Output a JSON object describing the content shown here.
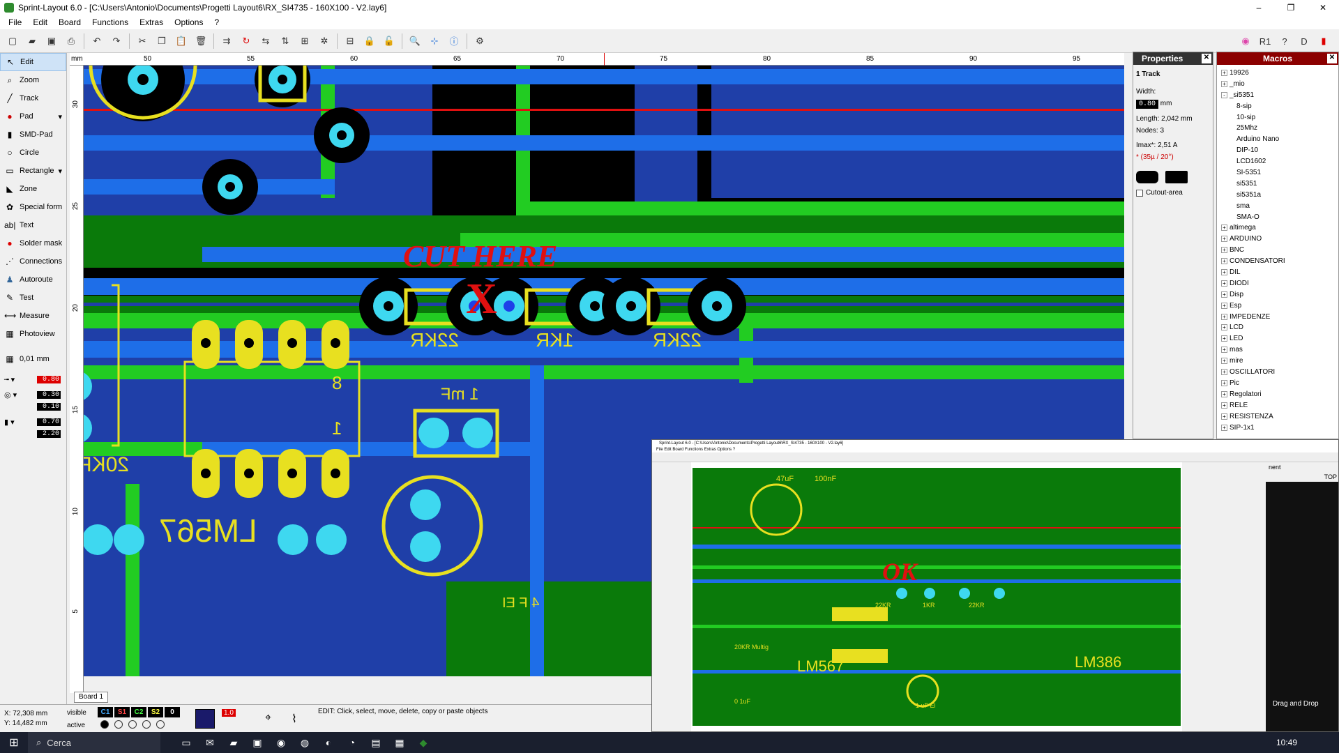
{
  "window": {
    "title": "Sprint-Layout 6.0 - [C:\\Users\\Antonio\\Documents\\Progetti Layout6\\RX_SI4735 - 160X100 - V2.lay6]",
    "minimize": "–",
    "maximize": "❐",
    "close": "✕"
  },
  "menu": [
    "File",
    "Edit",
    "Board",
    "Functions",
    "Extras",
    "Options",
    "?"
  ],
  "left_tools": [
    {
      "label": "Edit",
      "icon": "pointer-icon",
      "glyph": "↖"
    },
    {
      "label": "Zoom",
      "icon": "zoom-icon",
      "glyph": "⌕"
    },
    {
      "label": "Track",
      "icon": "track-icon",
      "glyph": "╱"
    },
    {
      "label": "Pad",
      "icon": "pad-icon",
      "glyph": "●"
    },
    {
      "label": "SMD-Pad",
      "icon": "smd-pad-icon",
      "glyph": "▮"
    },
    {
      "label": "Circle",
      "icon": "circle-icon",
      "glyph": "○"
    },
    {
      "label": "Rectangle",
      "icon": "rectangle-icon",
      "glyph": "▭"
    },
    {
      "label": "Zone",
      "icon": "zone-icon",
      "glyph": "◣"
    },
    {
      "label": "Special form",
      "icon": "special-form-icon",
      "glyph": "✿"
    },
    {
      "label": "Text",
      "icon": "text-icon",
      "glyph": "ab"
    },
    {
      "label": "Solder mask",
      "icon": "solder-mask-icon",
      "glyph": "●"
    },
    {
      "label": "Connections",
      "icon": "connections-icon",
      "glyph": "⋰"
    },
    {
      "label": "Autoroute",
      "icon": "autoroute-icon",
      "glyph": "♟"
    },
    {
      "label": "Test",
      "icon": "test-icon",
      "glyph": "✎"
    },
    {
      "label": "Measure",
      "icon": "measure-icon",
      "glyph": "⟷"
    },
    {
      "label": "Photoview",
      "icon": "photoview-icon",
      "glyph": "▦"
    }
  ],
  "grid": "0,01 mm",
  "values": {
    "track_width": "0.80",
    "pad_outer": "0.30",
    "pad_inner": "0.10",
    "smd_w": "0.70",
    "smd_h": "2.20"
  },
  "ruler": {
    "unit": "mm",
    "h_ticks": [
      "50",
      "55",
      "60",
      "65",
      "70",
      "75",
      "80",
      "85",
      "90",
      "95"
    ],
    "v_ticks": [
      "30",
      "25",
      "20",
      "15",
      "10",
      "5"
    ]
  },
  "board": {
    "annotation_cut": "CUT HERE",
    "annotation_x": "X",
    "labels": {
      "r1": "22KR",
      "r2": "1KR",
      "r3": "22KR",
      "cap": "1 mF",
      "r4": "20KR",
      "ic": "LM567",
      "pin8": "8",
      "pin1": "1",
      "fei": "4 F EI"
    }
  },
  "properties": {
    "title": "Properties",
    "object": "1 Track",
    "width_label": "Width:",
    "width_value": "0.80",
    "width_unit": "mm",
    "length": "Length: 2,042 mm",
    "nodes": "Nodes:  3",
    "imax": "Imax*:   2,51 A",
    "imax_note": "* (35µ / 20°)",
    "cutout": "Cutout-area"
  },
  "macros": {
    "title": "Macros",
    "items": [
      {
        "label": "19926",
        "child": false,
        "pm": "+"
      },
      {
        "label": "_mio",
        "child": false,
        "pm": "+"
      },
      {
        "label": "_si5351",
        "child": false,
        "pm": "-"
      },
      {
        "label": "8-sip",
        "child": true
      },
      {
        "label": "10-sip",
        "child": true
      },
      {
        "label": "25Mhz",
        "child": true
      },
      {
        "label": "Arduino Nano",
        "child": true
      },
      {
        "label": "DIP-10",
        "child": true
      },
      {
        "label": "LCD1602",
        "child": true
      },
      {
        "label": "SI-5351",
        "child": true
      },
      {
        "label": "si5351",
        "child": true
      },
      {
        "label": "si5351a",
        "child": true
      },
      {
        "label": "sma",
        "child": true
      },
      {
        "label": "SMA-O",
        "child": true
      },
      {
        "label": "altimega",
        "child": false,
        "pm": "+"
      },
      {
        "label": "ARDUINO",
        "child": false,
        "pm": "+"
      },
      {
        "label": "BNC",
        "child": false,
        "pm": "+"
      },
      {
        "label": "CONDENSATORI",
        "child": false,
        "pm": "+"
      },
      {
        "label": "DIL",
        "child": false,
        "pm": "+"
      },
      {
        "label": "DIODI",
        "child": false,
        "pm": "+"
      },
      {
        "label": "Disp",
        "child": false,
        "pm": "+"
      },
      {
        "label": "Esp",
        "child": false,
        "pm": "+"
      },
      {
        "label": "IMPEDENZE",
        "child": false,
        "pm": "+"
      },
      {
        "label": "LCD",
        "child": false,
        "pm": "+"
      },
      {
        "label": "LED",
        "child": false,
        "pm": "+"
      },
      {
        "label": "mas",
        "child": false,
        "pm": "+"
      },
      {
        "label": "mire",
        "child": false,
        "pm": "+"
      },
      {
        "label": "OSCILLATORI",
        "child": false,
        "pm": "+"
      },
      {
        "label": "Pic",
        "child": false,
        "pm": "+"
      },
      {
        "label": "Regolatori",
        "child": false,
        "pm": "+"
      },
      {
        "label": "RELE",
        "child": false,
        "pm": "+"
      },
      {
        "label": "RESISTENZA",
        "child": false,
        "pm": "+"
      },
      {
        "label": "SIP-1x1",
        "child": false,
        "pm": "+"
      }
    ]
  },
  "status": {
    "x": "X:  72,308 mm",
    "y": "Y:  14,482 mm",
    "visible": "visible",
    "active": "active",
    "layers": [
      "C1",
      "S1",
      "C2",
      "S2",
      "0"
    ],
    "zoom_val": "1.0",
    "message": "EDIT:  Click, select, move, delete, copy or paste objects",
    "board_tab": "Board 1"
  },
  "embedded": {
    "title": "Sprint-Layout 6.0 - [C:\\Users\\Antonio\\Documents\\Progetti Layout6\\RX_SI4735 - 160X100 - V2.lay6]",
    "ok_label": "OK",
    "labels": [
      "47uF",
      "100nF",
      "22KR",
      "1KR",
      "22KR",
      "LM567",
      "LM386",
      "20KR Multig",
      "1 uF El",
      "0 1uF"
    ],
    "side_text": "Drag and Drop",
    "component_label": "nent",
    "top_label": "TOP"
  },
  "taskbar": {
    "search": "Cerca",
    "clock": "10:49"
  },
  "colors": {
    "board_green": "#0a7a0a",
    "track_blue": "#1e6ee8",
    "pad_cyan": "#3ed8f0",
    "silk_yellow": "#e8e020",
    "copper_green": "#22cc22",
    "annotation_red": "#e01010",
    "macros_header": "#8b0000"
  }
}
